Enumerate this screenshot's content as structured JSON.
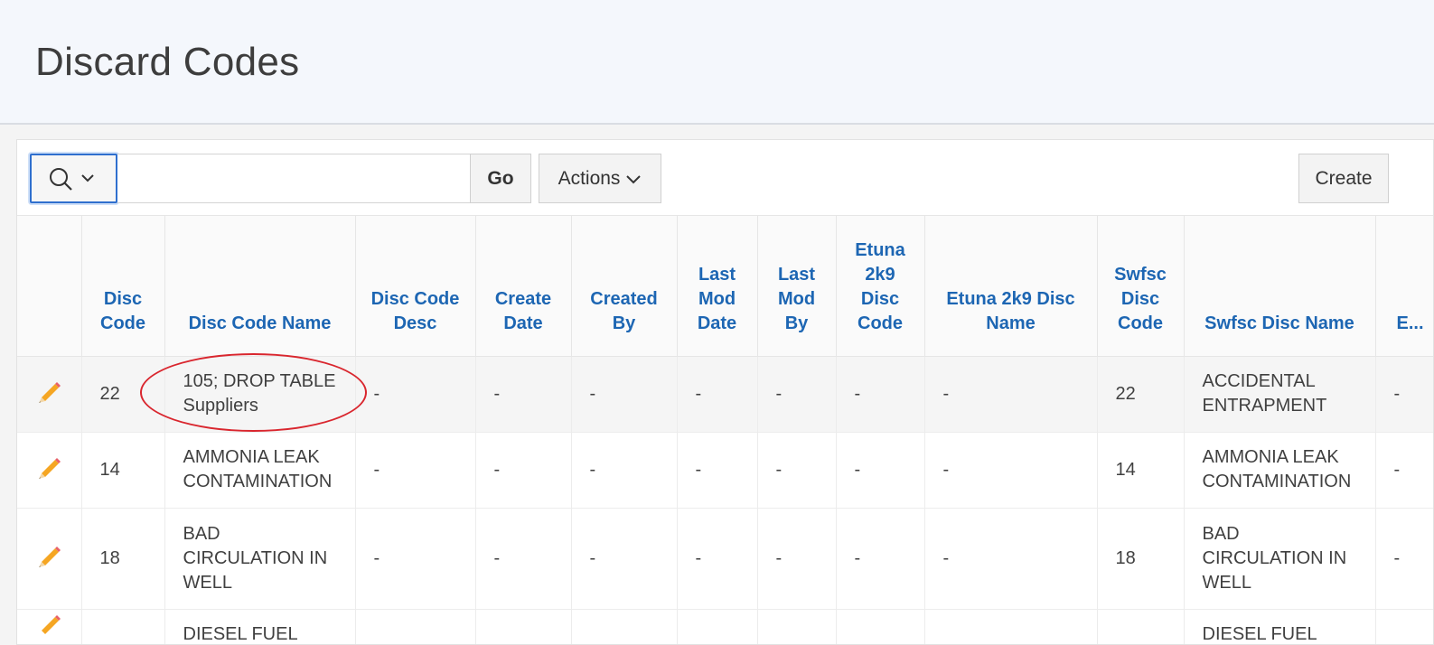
{
  "page": {
    "title": "Discard Codes"
  },
  "toolbar": {
    "search_placeholder": "",
    "go_label": "Go",
    "actions_label": "Actions",
    "create_label": "Create"
  },
  "table": {
    "headers": [
      "",
      "Disc Code",
      "Disc Code Name",
      "Disc Code Desc",
      "Create Date",
      "Created By",
      "Last Mod Date",
      "Last Mod By",
      "Etuna 2k9 Disc Code",
      "Etuna 2k9 Disc Name",
      "Swfsc Disc Code",
      "Swfsc Disc Name",
      "E..."
    ],
    "rows": [
      {
        "code": "22",
        "name": "105; DROP TABLE Suppliers",
        "desc": "-",
        "create_date": "-",
        "created_by": "-",
        "last_mod_date": "-",
        "last_mod_by": "-",
        "etuna_code": "-",
        "etuna_name": "-",
        "swfsc_code": "22",
        "swfsc_name": "ACCIDENTAL ENTRAPMENT",
        "extra": "-"
      },
      {
        "code": "14",
        "name": "AMMONIA LEAK CONTAMINATION",
        "desc": "-",
        "create_date": "-",
        "created_by": "-",
        "last_mod_date": "-",
        "last_mod_by": "-",
        "etuna_code": "-",
        "etuna_name": "-",
        "swfsc_code": "14",
        "swfsc_name": "AMMONIA LEAK CONTAMINATION",
        "extra": "-"
      },
      {
        "code": "18",
        "name": "BAD CIRCULATION IN WELL",
        "desc": "-",
        "create_date": "-",
        "created_by": "-",
        "last_mod_date": "-",
        "last_mod_by": "-",
        "etuna_code": "-",
        "etuna_name": "-",
        "swfsc_code": "18",
        "swfsc_name": "BAD CIRCULATION IN WELL",
        "extra": "-"
      },
      {
        "code": "",
        "name": "DIESEL FUEL",
        "desc": "",
        "create_date": "",
        "created_by": "",
        "last_mod_date": "",
        "last_mod_by": "",
        "etuna_code": "",
        "etuna_name": "",
        "swfsc_code": "",
        "swfsc_name": "DIESEL FUEL",
        "extra": ""
      }
    ]
  },
  "colors": {
    "header_link": "#1d66b3",
    "annotation": "#d9262e",
    "focus": "#2f6fce"
  },
  "icons": {
    "search": "magnifier-icon",
    "chevron": "chevron-down-icon",
    "edit": "pencil-icon"
  }
}
